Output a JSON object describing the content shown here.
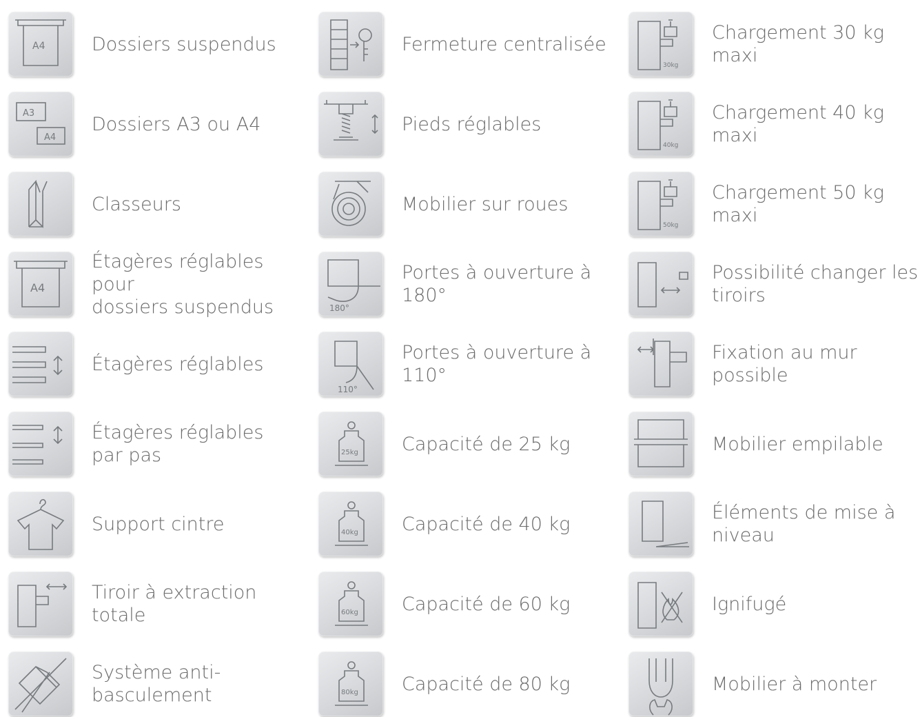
{
  "columns": [
    {
      "items": [
        {
          "icon": "hanging-file-a4-icon",
          "label": "Dossiers suspendus",
          "badge": "A4"
        },
        {
          "icon": "a3-a4-folders-icon",
          "label": "Dossiers A3 ou A4",
          "badge": "A3",
          "badge2": "A4"
        },
        {
          "icon": "binders-icon",
          "label": "Classeurs"
        },
        {
          "icon": "adjustable-shelf-hanging-file-icon",
          "label": "Étagères réglables pour\ndossiers suspendus",
          "badge": "A4"
        },
        {
          "icon": "adjustable-shelves-icon",
          "label": "Étagères réglables"
        },
        {
          "icon": "step-adjustable-shelves-icon",
          "label": "Étagères réglables\npar pas"
        },
        {
          "icon": "hanger-support-icon",
          "label": "Support cintre"
        },
        {
          "icon": "full-extension-drawer-icon",
          "label": "Tiroir à extraction totale"
        },
        {
          "icon": "anti-tilt-icon",
          "label": "Système anti-\nbasculement"
        }
      ]
    },
    {
      "items": [
        {
          "icon": "central-lock-icon",
          "label": "Fermeture centralisée"
        },
        {
          "icon": "adjustable-feet-icon",
          "label": "Pieds réglables"
        },
        {
          "icon": "caster-wheel-icon",
          "label": "Mobilier sur roues"
        },
        {
          "icon": "door-180-icon",
          "label": "Portes à ouverture à\n180°",
          "badge": "180°"
        },
        {
          "icon": "door-110-icon",
          "label": "Portes à ouverture à\n110°",
          "badge": "110°"
        },
        {
          "icon": "weight-25kg-icon",
          "label": "Capacité de 25 kg",
          "badge": "25kg"
        },
        {
          "icon": "weight-40kg-icon",
          "label": "Capacité de 40 kg",
          "badge": "40kg"
        },
        {
          "icon": "weight-60kg-icon",
          "label": "Capacité de 60 kg",
          "badge": "60kg"
        },
        {
          "icon": "weight-80kg-icon",
          "label": "Capacité de 80 kg",
          "badge": "80kg"
        }
      ]
    },
    {
      "items": [
        {
          "icon": "load-30kg-icon",
          "label": "Chargement 30 kg maxi",
          "badge": "30kg"
        },
        {
          "icon": "load-40kg-icon",
          "label": "Chargement 40 kg maxi",
          "badge": "40kg"
        },
        {
          "icon": "load-50kg-icon",
          "label": "Chargement 50 kg maxi",
          "badge": "50kg"
        },
        {
          "icon": "changeable-drawers-icon",
          "label": "Possibilité changer les\ntiroirs"
        },
        {
          "icon": "wall-mount-icon",
          "label": "Fixation au mur possible"
        },
        {
          "icon": "stackable-icon",
          "label": "Mobilier empilable"
        },
        {
          "icon": "leveling-elements-icon",
          "label": "Éléments de mise à\nniveau"
        },
        {
          "icon": "fireproof-icon",
          "label": "Ignifugé"
        },
        {
          "icon": "assembly-required-icon",
          "label": "Mobilier à monter"
        }
      ]
    }
  ]
}
